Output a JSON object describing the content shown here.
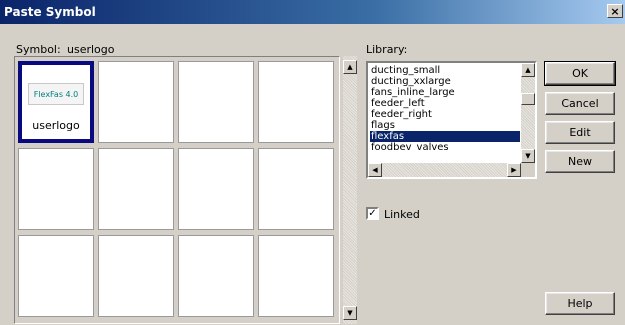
{
  "window": {
    "title": "Paste Symbol",
    "close_glyph": "×"
  },
  "symbol": {
    "label": "Symbol:",
    "value": "userlogo"
  },
  "grid": {
    "selected_cell": {
      "thumbnail_text": "FlexFas 4.0",
      "label": "userlogo"
    }
  },
  "library": {
    "label": "Library:",
    "items": [
      "ducting_small",
      "ducting_xxlarge",
      "fans_inline_large",
      "feeder_left",
      "feeder_right",
      "flags",
      "flexfas",
      "foodbev_valves"
    ],
    "selected": "flexfas"
  },
  "linked": {
    "label": "Linked",
    "checked": true,
    "check_glyph": "✓"
  },
  "buttons": {
    "ok": "OK",
    "cancel": "Cancel",
    "edit": "Edit",
    "new": "New",
    "help": "Help"
  },
  "scroll_glyphs": {
    "up": "▲",
    "down": "▼",
    "left": "◀",
    "right": "▶"
  }
}
